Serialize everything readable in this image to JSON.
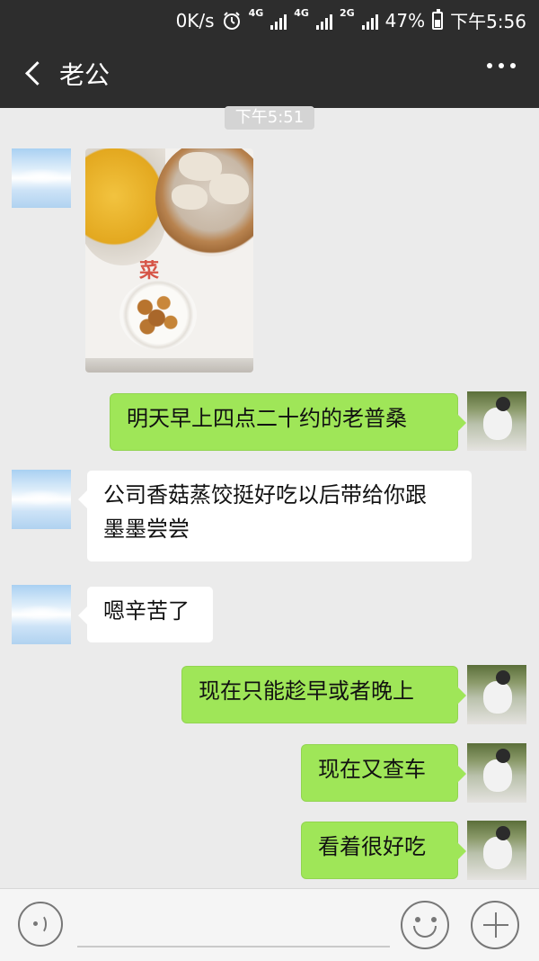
{
  "status_bar": {
    "speed": "0K/s",
    "network_1": "4G",
    "network_2": "4G",
    "network_3": "2G",
    "battery": "47%",
    "time": "下午5:56",
    "icons": [
      "alarm-icon",
      "signal-icon",
      "battery-icon"
    ]
  },
  "header": {
    "title": "老公",
    "back_icon": "chevron-left-icon",
    "more_icon": "more-dots-icon"
  },
  "chat": {
    "time_label": "下午5:51",
    "messages": [
      {
        "side": "in",
        "type": "image",
        "image_name": "dumplings-photo"
      },
      {
        "side": "out",
        "type": "text",
        "text": "明天早上四点二十约的老普桑"
      },
      {
        "side": "in",
        "type": "text",
        "line1": "公司香菇蒸饺挺好吃以后带给你跟",
        "line2": "墨墨尝尝"
      },
      {
        "side": "in",
        "type": "text",
        "text": "嗯辛苦了"
      },
      {
        "side": "out",
        "type": "text",
        "text": "现在只能趁早或者晚上"
      },
      {
        "side": "out",
        "type": "text",
        "text": "现在又查车"
      },
      {
        "side": "out",
        "type": "text",
        "text": "看着很好吃"
      }
    ],
    "photo_logo_text": "菜"
  },
  "input_bar": {
    "voice_icon": "voice-icon",
    "emoji_icon": "emoji-icon",
    "plus_icon": "plus-icon"
  },
  "colors": {
    "top_bar": "#2d2d2d",
    "background": "#ebebeb",
    "outgoing_bubble": "#9fe658",
    "incoming_bubble": "#ffffff"
  }
}
